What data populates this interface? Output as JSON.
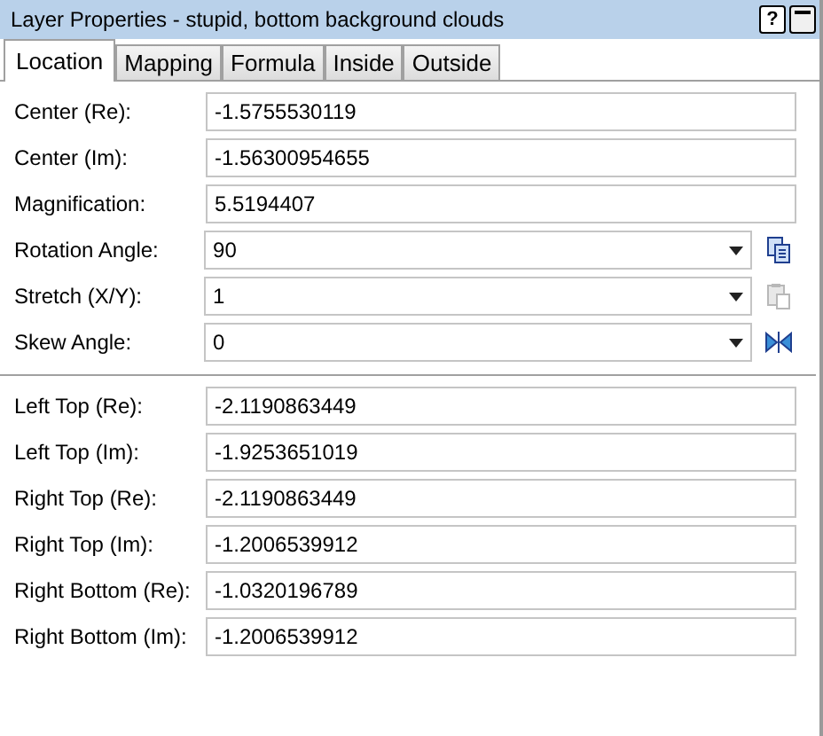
{
  "window": {
    "title": "Layer Properties - stupid, bottom background clouds",
    "buttons": [
      "?"
    ]
  },
  "tabs": [
    {
      "label": "Location",
      "selected": true
    },
    {
      "label": "Mapping",
      "selected": false
    },
    {
      "label": "Formula",
      "selected": false
    },
    {
      "label": "Inside",
      "selected": false
    },
    {
      "label": "Outside",
      "selected": false
    }
  ],
  "fields": [
    {
      "label": "Center (Re):",
      "value": "-1.5755530119",
      "kind": "text"
    },
    {
      "label": "Center (Im):",
      "value": "-1.56300954655",
      "kind": "text"
    },
    {
      "label": "Magnification:",
      "value": "5.5194407",
      "kind": "text"
    },
    {
      "label": "Rotation Angle:",
      "value": "90",
      "kind": "combo",
      "action": {
        "kind": "copy",
        "disabled": false
      }
    },
    {
      "label": "Stretch (X/Y):",
      "value": "1",
      "kind": "combo",
      "action": {
        "kind": "paste",
        "disabled": true
      }
    },
    {
      "label": "Skew Angle:",
      "value": "0",
      "kind": "combo",
      "action": {
        "kind": "mirror",
        "disabled": false
      }
    }
  ],
  "corners": [
    {
      "label": "Left Top (Re):",
      "value": "-2.1190863449"
    },
    {
      "label": "Left Top (Im):",
      "value": "-1.9253651019"
    },
    {
      "label": "Right Top (Re):",
      "value": "-2.1190863449"
    },
    {
      "label": "Right Top (Im):",
      "value": "-1.2006539912"
    },
    {
      "label": "Right Bottom (Re):",
      "value": "-1.0320196789"
    },
    {
      "label": "Right Bottom (Im):",
      "value": "-1.2006539912"
    }
  ]
}
